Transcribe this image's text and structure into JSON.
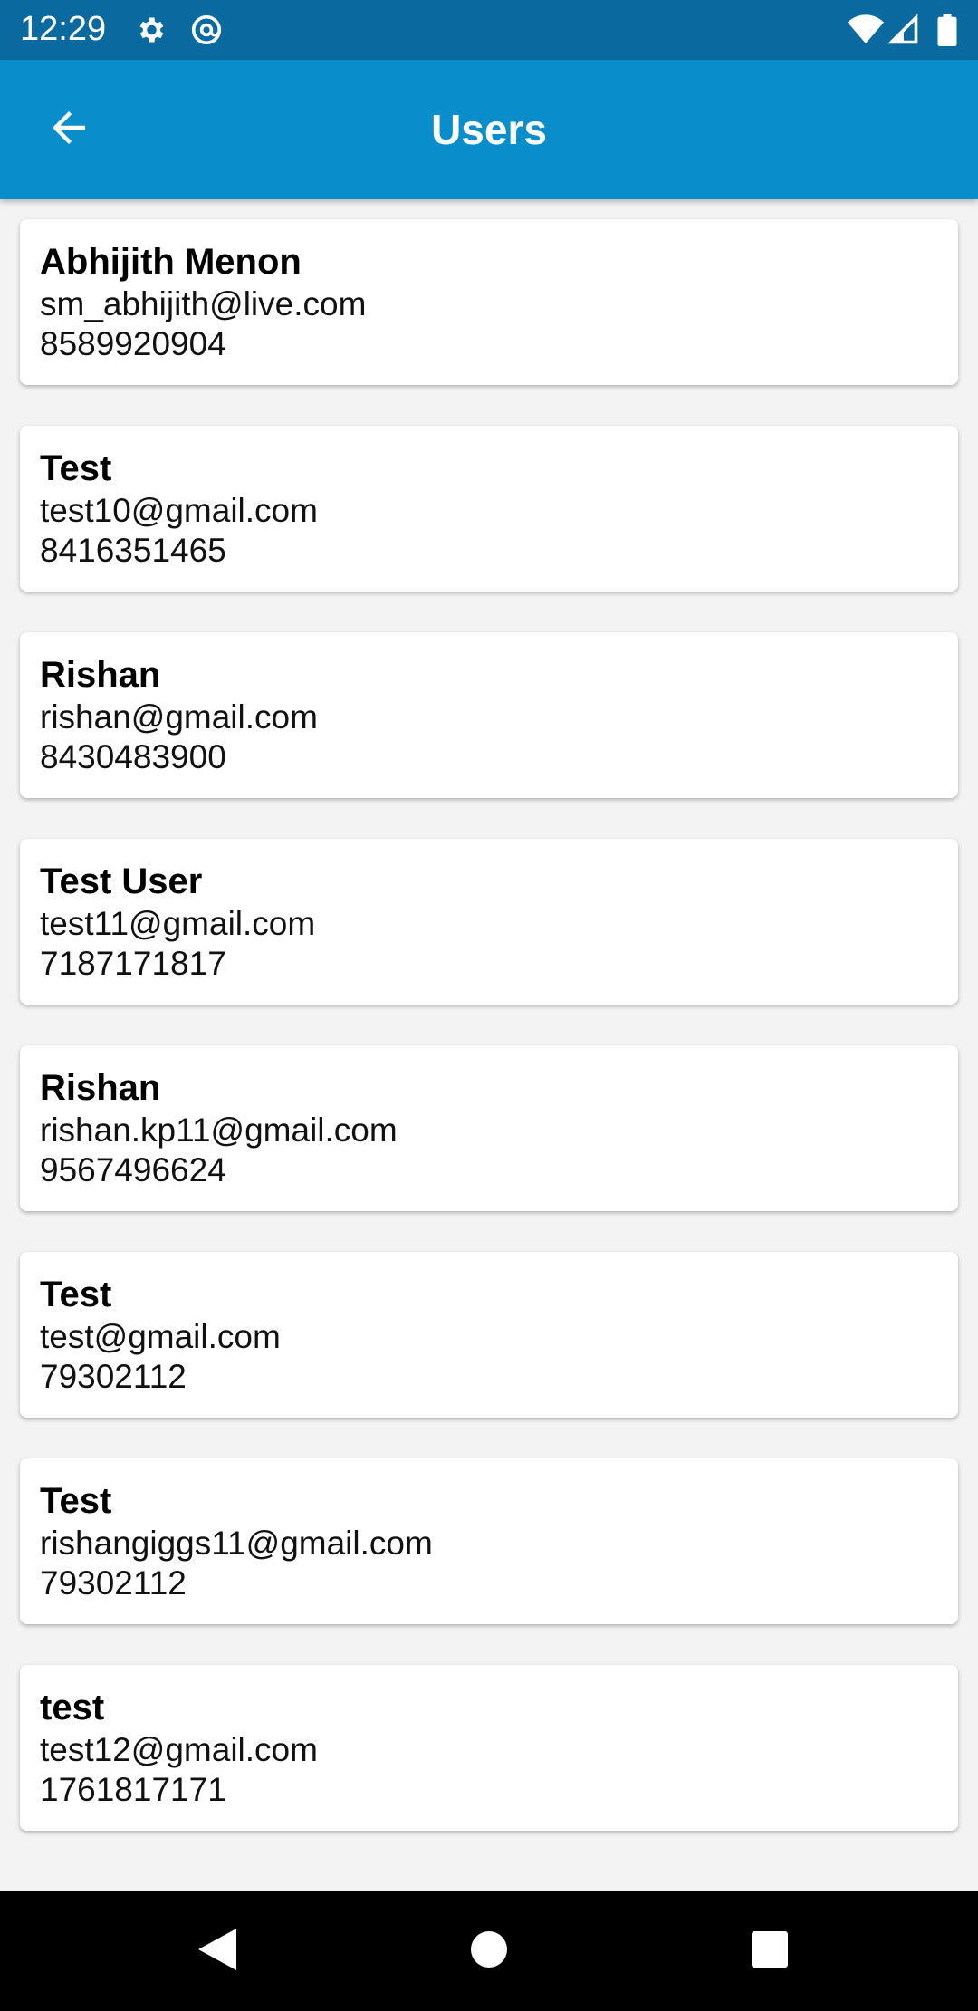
{
  "status_bar": {
    "time": "12:29",
    "icons": [
      "settings-gear-icon",
      "at-sign-icon",
      "wifi-icon",
      "cellular-signal-icon",
      "battery-icon"
    ]
  },
  "app_bar": {
    "back_icon": "arrow-left-icon",
    "title": "Users",
    "color": "#0a8ecb"
  },
  "users": [
    {
      "name": "Abhijith Menon",
      "email": "sm_abhijith@live.com",
      "phone": "8589920904"
    },
    {
      "name": "Test",
      "email": "test10@gmail.com",
      "phone": "8416351465"
    },
    {
      "name": "Rishan",
      "email": "rishan@gmail.com",
      "phone": "8430483900"
    },
    {
      "name": "Test User",
      "email": "test11@gmail.com",
      "phone": "7187171817"
    },
    {
      "name": "Rishan",
      "email": "rishan.kp11@gmail.com",
      "phone": "9567496624"
    },
    {
      "name": "Test",
      "email": "test@gmail.com",
      "phone": "79302112"
    },
    {
      "name": "Test",
      "email": "rishangiggs11@gmail.com",
      "phone": "79302112"
    },
    {
      "name": "test",
      "email": "test12@gmail.com",
      "phone": "1761817171"
    }
  ],
  "nav_bar": {
    "icons": [
      "back-triangle-icon",
      "home-circle-icon",
      "recents-square-icon"
    ]
  }
}
